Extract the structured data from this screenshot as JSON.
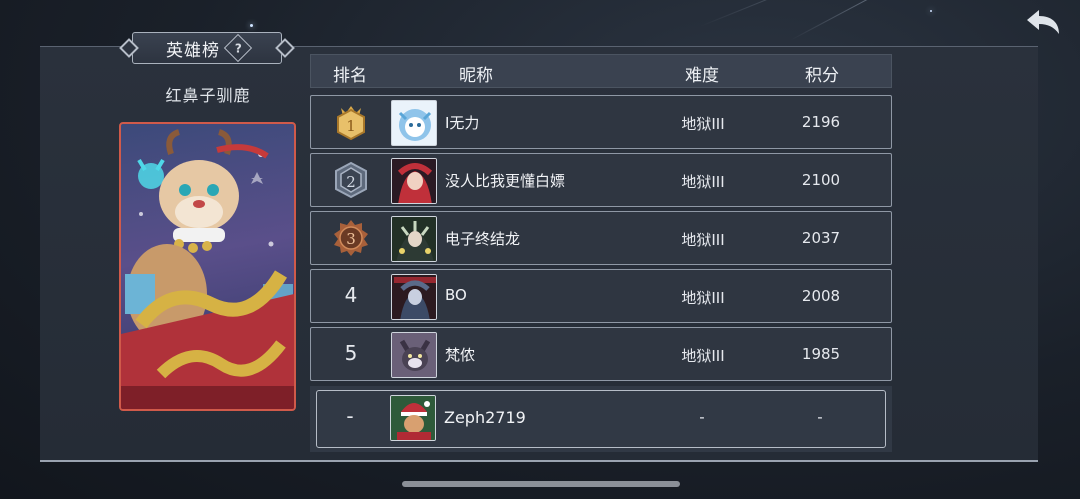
{
  "leaderboard": {
    "title": "英雄榜",
    "help_icon_text": "?",
    "skin_name": "红鼻子驯鹿",
    "headers": {
      "rank": "排名",
      "nickname": "昵称",
      "difficulty": "难度",
      "score": "积分"
    },
    "rows": [
      {
        "rank": "1",
        "badge": "gold-crown",
        "nickname": "I无力",
        "difficulty": "地狱III",
        "score": "2196"
      },
      {
        "rank": "2",
        "badge": "silver",
        "nickname": "没人比我更懂白嫖",
        "difficulty": "地狱III",
        "score": "2100"
      },
      {
        "rank": "3",
        "badge": "bronze",
        "nickname": "电子终结龙",
        "difficulty": "地狱III",
        "score": "2037"
      },
      {
        "rank": "4",
        "badge": "",
        "nickname": "BO",
        "difficulty": "地狱III",
        "score": "2008"
      },
      {
        "rank": "5",
        "badge": "",
        "nickname": "梵侬",
        "difficulty": "地狱III",
        "score": "1985"
      }
    ],
    "self": {
      "rank": "-",
      "nickname": "Zeph2719",
      "difficulty": "-",
      "score": "-"
    }
  },
  "icons": {
    "back": "back-arrow-icon",
    "help": "question-icon"
  },
  "colors": {
    "gold": "#d9a94a",
    "silver": "#9aa6b8",
    "bronze": "#c27a4a",
    "card_border": "#d05a4a"
  }
}
